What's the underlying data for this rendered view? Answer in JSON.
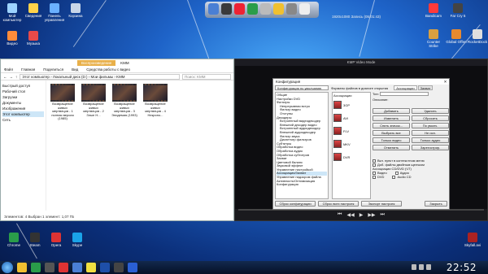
{
  "desktop": {
    "icons_top": [
      {
        "label": "Мой компьютер"
      },
      {
        "label": "Сведения"
      },
      {
        "label": "Панель управления"
      },
      {
        "label": "Корзина"
      },
      {
        "label": "Видео"
      },
      {
        "label": "Музыка"
      }
    ],
    "icons_right": [
      {
        "label": "Bandicam"
      },
      {
        "label": "Far Cry 5"
      },
      {
        "label": "Counter Strike"
      },
      {
        "label": "Global Offen"
      },
      {
        "label": "RocketDock"
      }
    ],
    "icons_bottom": [
      {
        "label": "Chrome"
      },
      {
        "label": "Steam"
      },
      {
        "label": "Opera"
      },
      {
        "label": "Skype"
      }
    ],
    "bottom_right_icon": {
      "label": "Skyfall.avi"
    },
    "widget_text": "1920x1080   Запись (05:01:43)"
  },
  "explorer": {
    "title_tab": "Воспроизведение",
    "title_name": "KMM",
    "ribbon": [
      "Файл",
      "Главная",
      "Поделиться",
      "Вид",
      "Средства работы с видео"
    ],
    "address_path": "Этот компьютер  ›  Локальный диск (D:)  ›  Мои фильмы  ›  KMM",
    "search_placeholder": "Поиск: KMM",
    "nav": [
      {
        "label": "Быстрый доступ",
        "selected": false
      },
      {
        "label": "Рабочий стол",
        "selected": false
      },
      {
        "label": "Загрузки",
        "selected": false
      },
      {
        "label": "Документы",
        "selected": false
      },
      {
        "label": "Изображения",
        "selected": false
      },
      {
        "label": "Этот компьютер",
        "selected": true
      },
      {
        "label": "Сеть",
        "selected": false
      }
    ],
    "files": [
      {
        "name": "Возвращение живых мертвецов - 1 полная версия (1985)"
      },
      {
        "name": "Возвращение живых мертвецов - 2 Злые Н..."
      },
      {
        "name": "Возвращение живых мертвецов - 3 Эпидемия (1993)"
      },
      {
        "name": "Возвращение живых мертвецов - 4 Некропо..."
      }
    ],
    "status": "Элементов: 4    Выбран 1 элемент: 1,07 ГБ"
  },
  "player": {
    "title": "KMP Video Mode",
    "controls": [
      "⏮",
      "◀◀",
      "▶",
      "▶▶",
      "⏭"
    ]
  },
  "config_dialog": {
    "title": "Конфигурация",
    "profile": "Конфигурация по умолчанию",
    "heading": "Форматы файлов в диалоге открытия",
    "tabs": [
      {
        "label": "Ассоциации",
        "active": true
      },
      {
        "label": "Захват",
        "active": false
      }
    ],
    "tree": [
      "Общие",
      "Настройки DVD",
      "Фильтры",
      "Непрерывная встро",
      "Фильтр видео",
      "Отступы",
      "Декодеры",
      "Встроенный видеодекодер",
      "Внешний декодер видео",
      "Встроенный аудиодекодер",
      "Внешний аудиодекодер",
      "Фильтр звука",
      "Диспетчер фильтров",
      "Субтитры",
      "Обработка видео",
      "Обработка аудио",
      "Обработка субтитров",
      "Захват",
      "Цветовой баланс",
      "Звуковой эффект",
      "Управление настройкой",
      "Ассоциации/Захват",
      "Управление надзором файла",
      "Активность/Оптимизация",
      "Конфигурация"
    ],
    "section_label": "Ассоциации",
    "assoc_files": [
      {
        "label": "3GP"
      },
      {
        "label": "AVI"
      },
      {
        "label": "FLV"
      },
      {
        "label": "MKV"
      },
      {
        "label": "DVR"
      }
    ],
    "type_label": "Тип:",
    "desc_label": "Описание:",
    "buttons": [
      "Добавить",
      "Удалить",
      "Изменить",
      "Сбросить",
      "Снять значок...",
      "По умолч.",
      "Выбрать все",
      "Не исп.",
      "Только видео",
      "Только аудио",
      "Отменить",
      "Зарегистрир."
    ],
    "checks": [
      "Вкл. пункт в контекстном меню",
      "Доб. файлы двойным щелчком",
      "Ассоциации CD/DVD (ЧТ)",
      "Видео",
      "Аудио",
      "DVD",
      "Audio CD"
    ],
    "bottom_buttons": [
      "Сброс конфигурации",
      "Сброс всех настроек",
      "Экспорт настроек"
    ],
    "ok_label": "Закрыть"
  },
  "taskbar": {
    "clock": "22:52",
    "icons": [
      "folder",
      "chrome",
      "media",
      "opera",
      "explorer",
      "yandex",
      "photoshop",
      "video",
      "word"
    ]
  },
  "colors": {
    "accent": "#e8b04a",
    "desktop": "#1e63c8"
  }
}
